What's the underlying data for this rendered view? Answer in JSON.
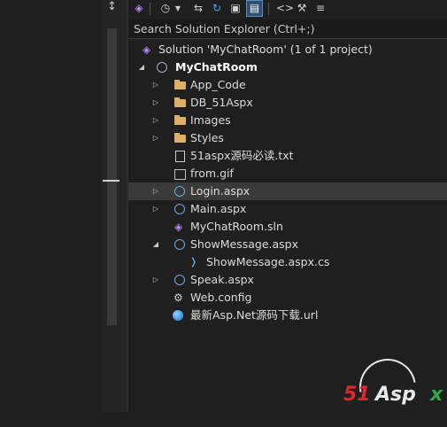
{
  "search": {
    "placeholder": "Search Solution Explorer (Ctrl+;)"
  },
  "toolbar": {
    "pin": "↕",
    "icons": [
      "vs-switch-icon",
      "history-icon",
      "sync-arrows-icon",
      "refresh-icon",
      "collapse-icon",
      "show-all-files-icon",
      "code-icon",
      "properties-wrench-icon",
      "preview-icon"
    ]
  },
  "tree": {
    "solution": "Solution 'MyChatRoom' (1 of 1 project)",
    "project": "MyChatRoom",
    "items": [
      {
        "label": "App_Code",
        "icon": "folder-icon"
      },
      {
        "label": "DB_51Aspx",
        "icon": "folder-icon"
      },
      {
        "label": "Images",
        "icon": "folder-icon"
      },
      {
        "label": "Styles",
        "icon": "folder-icon"
      },
      {
        "label": "51aspx源码必读.txt",
        "icon": "text-file-icon"
      },
      {
        "label": "from.gif",
        "icon": "image-file-icon"
      },
      {
        "label": "Login.aspx",
        "icon": "aspx-page-icon"
      },
      {
        "label": "Main.aspx",
        "icon": "aspx-page-icon"
      },
      {
        "label": "MyChatRoom.sln",
        "icon": "solution-file-icon"
      },
      {
        "label": "ShowMessage.aspx",
        "icon": "aspx-page-icon"
      },
      {
        "label": "ShowMessage.aspx.cs",
        "icon": "csharp-file-icon"
      },
      {
        "label": "Speak.aspx",
        "icon": "aspx-page-icon"
      },
      {
        "label": "Web.config",
        "icon": "config-file-icon"
      },
      {
        "label": "最新Asp.Net源码下载.url",
        "icon": "url-shortcut-icon"
      }
    ]
  },
  "watermark": {
    "brand_number": "51",
    "brand_text": "Asp",
    "brand_x": "x"
  },
  "colors": {
    "background": "#1f1f1f",
    "selection": "#3a3a3a",
    "folder": "#dcb067",
    "accent": "#b58af5"
  }
}
